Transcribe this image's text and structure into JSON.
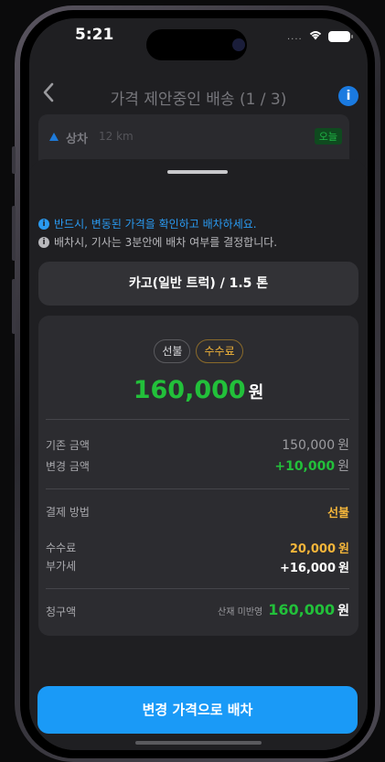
{
  "status_bar": {
    "time": "5:21",
    "signal": "....",
    "wifi_icon": "wifi-icon",
    "battery_icon": "battery-icon"
  },
  "nav": {
    "back_icon": "chevron-left-icon",
    "title": "가격 제안중인 배송 (1 / 3)",
    "info_icon": "info-icon",
    "info_glyph": "i"
  },
  "peek_card": {
    "label": "상차",
    "distance": "12 km",
    "badge": "오늘"
  },
  "notices": [
    {
      "glyph": "i",
      "text": "반드시, 변동된 가격을 확인하고 배차하세요."
    },
    {
      "glyph": "i",
      "text": "배차시, 기사는 3분안에 배차 여부를 결정합니다."
    }
  ],
  "vehicle": {
    "label": "카고(일반 트럭) / 1.5 톤"
  },
  "price": {
    "badges": [
      "선불",
      "수수료"
    ],
    "total_amount": "160,000",
    "total_unit": "원",
    "base_label": "기존 금액",
    "base_value": "150,000",
    "base_unit": "원",
    "change_label": "변경 금액",
    "change_value": "+10,000",
    "change_unit": "원",
    "payment_label": "결제 방법",
    "payment_value": "선불",
    "fee_label": "수수료",
    "fee_value": "20,000",
    "fee_unit": "원",
    "vat_label": "부가세",
    "vat_value": "+16,000",
    "vat_unit": "원",
    "bill_label": "청구액",
    "bill_note": "산재 미반영",
    "bill_value": "160,000",
    "bill_unit": "원"
  },
  "cta": {
    "label": "변경 가격으로 배차"
  },
  "colors": {
    "accent": "#1a9af7",
    "green": "#22c03a",
    "gold": "#f3b53a"
  }
}
